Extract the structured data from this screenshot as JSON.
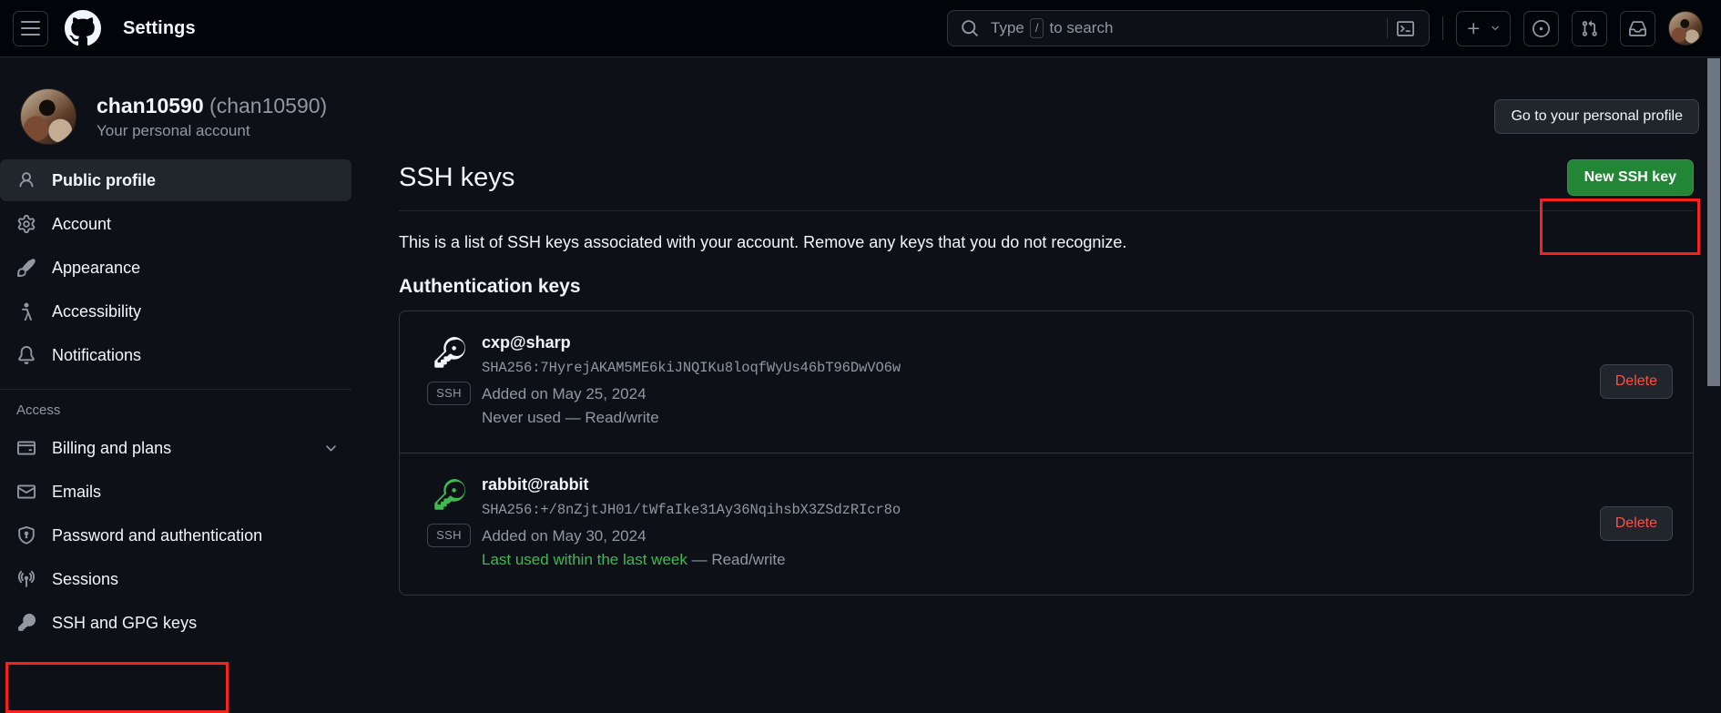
{
  "header": {
    "menu_icon": "hamburger-icon",
    "logo_icon": "github-logo-icon",
    "title": "Settings",
    "search": {
      "icon": "search-icon",
      "placeholder_prefix": "Type",
      "slash_key": "/",
      "placeholder_suffix": "to search",
      "terminal_icon": "terminal-icon"
    },
    "actions": [
      {
        "name": "create-new-button",
        "icon": "plus-icon",
        "has_chevron": true
      },
      {
        "name": "issues-button",
        "icon": "issue-opened-icon"
      },
      {
        "name": "pull-requests-button",
        "icon": "git-pull-request-icon"
      },
      {
        "name": "notifications-button",
        "icon": "inbox-icon"
      },
      {
        "name": "user-avatar-button",
        "icon": "avatar-icon"
      }
    ]
  },
  "account": {
    "name": "chan10590",
    "handle": "(chan10590)",
    "subtitle": "Your personal account",
    "profile_button": "Go to your personal profile"
  },
  "sidebar": {
    "items": [
      {
        "label": "Public profile",
        "icon": "person-icon",
        "selected": true
      },
      {
        "label": "Account",
        "icon": "gear-icon",
        "selected": false
      },
      {
        "label": "Appearance",
        "icon": "paintbrush-icon",
        "selected": false
      },
      {
        "label": "Accessibility",
        "icon": "accessibility-icon",
        "selected": false
      },
      {
        "label": "Notifications",
        "icon": "bell-icon",
        "selected": false
      }
    ],
    "section_title": "Access",
    "access_items": [
      {
        "label": "Billing and plans",
        "icon": "credit-card-icon",
        "chevron": true
      },
      {
        "label": "Emails",
        "icon": "mail-icon",
        "chevron": false
      },
      {
        "label": "Password and authentication",
        "icon": "shield-lock-icon",
        "chevron": false
      },
      {
        "label": "Sessions",
        "icon": "broadcast-icon",
        "chevron": false
      },
      {
        "label": "SSH and GPG keys",
        "icon": "key-icon",
        "chevron": false,
        "highlighted": true
      }
    ]
  },
  "main": {
    "title": "SSH keys",
    "new_key_button": "New SSH key",
    "intro": "This is a list of SSH keys associated with your account. Remove any keys that you do not recognize.",
    "section_heading": "Authentication keys",
    "keys": [
      {
        "title": "cxp@sharp",
        "fingerprint": "SHA256:7HyrejAKAM5ME6kiJNQIKu8loqfWyUs46bT96DwVO6w",
        "added": "Added on May 25, 2024",
        "usage": "Never used",
        "usage_is_recent": false,
        "permission": "— Read/write",
        "badge": "SSH",
        "delete_label": "Delete",
        "key_icon_color": "#f0f6fc"
      },
      {
        "title": "rabbit@rabbit",
        "fingerprint": "SHA256:+/8nZjtJH01/tWfaIke31Ay36NqihsbX3ZSdzRIcr8o",
        "added": "Added on May 30, 2024",
        "usage": "Last used within the last week",
        "usage_is_recent": true,
        "permission": "— Read/write",
        "badge": "SSH",
        "delete_label": "Delete",
        "key_icon_color": "#3fb950"
      }
    ]
  },
  "colors": {
    "page_bg": "#0d1117",
    "header_bg": "#010409",
    "accent_blue": "#1f6feb",
    "green_button": "#238636",
    "danger_red": "#f85149",
    "highlight_red": "#f5231f",
    "muted_text": "#9198a1",
    "green_text": "#3fb950"
  }
}
